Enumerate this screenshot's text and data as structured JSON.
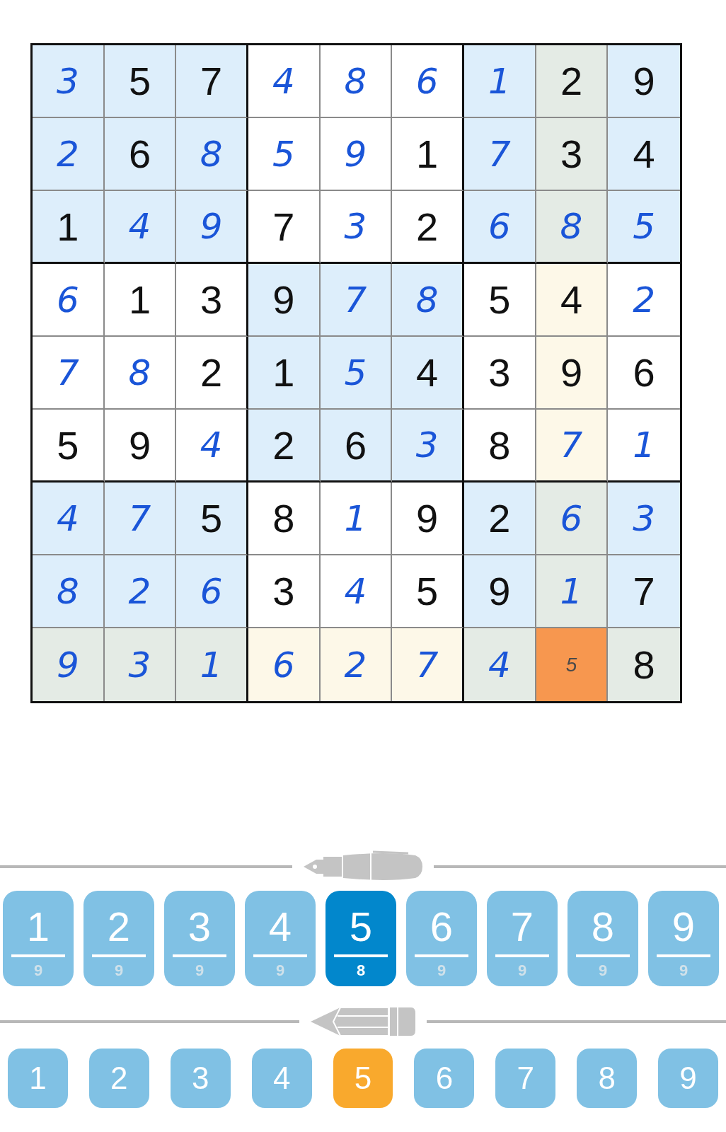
{
  "grid": {
    "rows": [
      [
        {
          "value": "3",
          "kind": "entered",
          "color": "#ddeefb"
        },
        {
          "value": "5",
          "kind": "given",
          "color": "#ddeefb"
        },
        {
          "value": "7",
          "kind": "given",
          "color": "#ddeefb"
        },
        {
          "value": "4",
          "kind": "entered",
          "color": "#ffffff"
        },
        {
          "value": "8",
          "kind": "entered",
          "color": "#ffffff"
        },
        {
          "value": "6",
          "kind": "entered",
          "color": "#ffffff"
        },
        {
          "value": "1",
          "kind": "entered",
          "color": "#ddeefb"
        },
        {
          "value": "2",
          "kind": "given",
          "color": "#e4ebe5"
        },
        {
          "value": "9",
          "kind": "given",
          "color": "#ddeefb"
        }
      ],
      [
        {
          "value": "2",
          "kind": "entered",
          "color": "#ddeefb"
        },
        {
          "value": "6",
          "kind": "given",
          "color": "#ddeefb"
        },
        {
          "value": "8",
          "kind": "entered",
          "color": "#ddeefb"
        },
        {
          "value": "5",
          "kind": "entered",
          "color": "#ffffff"
        },
        {
          "value": "9",
          "kind": "entered",
          "color": "#ffffff"
        },
        {
          "value": "1",
          "kind": "given",
          "color": "#ffffff"
        },
        {
          "value": "7",
          "kind": "entered",
          "color": "#ddeefb"
        },
        {
          "value": "3",
          "kind": "given",
          "color": "#e4ebe5"
        },
        {
          "value": "4",
          "kind": "given",
          "color": "#ddeefb"
        }
      ],
      [
        {
          "value": "1",
          "kind": "given",
          "color": "#ddeefb"
        },
        {
          "value": "4",
          "kind": "entered",
          "color": "#ddeefb"
        },
        {
          "value": "9",
          "kind": "entered",
          "color": "#ddeefb"
        },
        {
          "value": "7",
          "kind": "given",
          "color": "#ffffff"
        },
        {
          "value": "3",
          "kind": "entered",
          "color": "#ffffff"
        },
        {
          "value": "2",
          "kind": "given",
          "color": "#ffffff"
        },
        {
          "value": "6",
          "kind": "entered",
          "color": "#ddeefb"
        },
        {
          "value": "8",
          "kind": "entered",
          "color": "#e4ebe5"
        },
        {
          "value": "5",
          "kind": "entered",
          "color": "#ddeefb"
        }
      ],
      [
        {
          "value": "6",
          "kind": "entered",
          "color": "#ffffff"
        },
        {
          "value": "1",
          "kind": "given",
          "color": "#ffffff"
        },
        {
          "value": "3",
          "kind": "given",
          "color": "#ffffff"
        },
        {
          "value": "9",
          "kind": "given",
          "color": "#ddeefb"
        },
        {
          "value": "7",
          "kind": "entered",
          "color": "#ddeefb"
        },
        {
          "value": "8",
          "kind": "entered",
          "color": "#ddeefb"
        },
        {
          "value": "5",
          "kind": "given",
          "color": "#ffffff"
        },
        {
          "value": "4",
          "kind": "given",
          "color": "#fdf8e8"
        },
        {
          "value": "2",
          "kind": "entered",
          "color": "#ffffff"
        }
      ],
      [
        {
          "value": "7",
          "kind": "entered",
          "color": "#ffffff"
        },
        {
          "value": "8",
          "kind": "entered",
          "color": "#ffffff"
        },
        {
          "value": "2",
          "kind": "given",
          "color": "#ffffff"
        },
        {
          "value": "1",
          "kind": "given",
          "color": "#ddeefb"
        },
        {
          "value": "5",
          "kind": "entered",
          "color": "#ddeefb"
        },
        {
          "value": "4",
          "kind": "given",
          "color": "#ddeefb"
        },
        {
          "value": "3",
          "kind": "given",
          "color": "#ffffff"
        },
        {
          "value": "9",
          "kind": "given",
          "color": "#fdf8e8"
        },
        {
          "value": "6",
          "kind": "given",
          "color": "#ffffff"
        }
      ],
      [
        {
          "value": "5",
          "kind": "given",
          "color": "#ffffff"
        },
        {
          "value": "9",
          "kind": "given",
          "color": "#ffffff"
        },
        {
          "value": "4",
          "kind": "entered",
          "color": "#ffffff"
        },
        {
          "value": "2",
          "kind": "given",
          "color": "#ddeefb"
        },
        {
          "value": "6",
          "kind": "given",
          "color": "#ddeefb"
        },
        {
          "value": "3",
          "kind": "entered",
          "color": "#ddeefb"
        },
        {
          "value": "8",
          "kind": "given",
          "color": "#ffffff"
        },
        {
          "value": "7",
          "kind": "entered",
          "color": "#fdf8e8"
        },
        {
          "value": "1",
          "kind": "entered",
          "color": "#ffffff"
        }
      ],
      [
        {
          "value": "4",
          "kind": "entered",
          "color": "#ddeefb"
        },
        {
          "value": "7",
          "kind": "entered",
          "color": "#ddeefb"
        },
        {
          "value": "5",
          "kind": "given",
          "color": "#ddeefb"
        },
        {
          "value": "8",
          "kind": "given",
          "color": "#ffffff"
        },
        {
          "value": "1",
          "kind": "entered",
          "color": "#ffffff"
        },
        {
          "value": "9",
          "kind": "given",
          "color": "#ffffff"
        },
        {
          "value": "2",
          "kind": "given",
          "color": "#ddeefb"
        },
        {
          "value": "6",
          "kind": "entered",
          "color": "#e4ebe5"
        },
        {
          "value": "3",
          "kind": "entered",
          "color": "#ddeefb"
        }
      ],
      [
        {
          "value": "8",
          "kind": "entered",
          "color": "#ddeefb"
        },
        {
          "value": "2",
          "kind": "entered",
          "color": "#ddeefb"
        },
        {
          "value": "6",
          "kind": "entered",
          "color": "#ddeefb"
        },
        {
          "value": "3",
          "kind": "given",
          "color": "#ffffff"
        },
        {
          "value": "4",
          "kind": "entered",
          "color": "#ffffff"
        },
        {
          "value": "5",
          "kind": "given",
          "color": "#ffffff"
        },
        {
          "value": "9",
          "kind": "given",
          "color": "#ddeefb"
        },
        {
          "value": "1",
          "kind": "entered",
          "color": "#e4ebe5"
        },
        {
          "value": "7",
          "kind": "given",
          "color": "#ddeefb"
        }
      ],
      [
        {
          "value": "9",
          "kind": "entered",
          "color": "#e4ebe5"
        },
        {
          "value": "3",
          "kind": "entered",
          "color": "#e4ebe5"
        },
        {
          "value": "1",
          "kind": "entered",
          "color": "#e4ebe5"
        },
        {
          "value": "6",
          "kind": "entered",
          "color": "#fdf8e8"
        },
        {
          "value": "2",
          "kind": "entered",
          "color": "#fdf8e8"
        },
        {
          "value": "7",
          "kind": "entered",
          "color": "#fdf8e8"
        },
        {
          "value": "4",
          "kind": "entered",
          "color": "#e4ebe5"
        },
        {
          "value": "5",
          "kind": "note",
          "color": "#f7974f"
        },
        {
          "value": "8",
          "kind": "given",
          "color": "#e4ebe5"
        }
      ]
    ]
  },
  "pen_buttons": [
    {
      "digit": "1",
      "count": "9",
      "selected": false
    },
    {
      "digit": "2",
      "count": "9",
      "selected": false
    },
    {
      "digit": "3",
      "count": "9",
      "selected": false
    },
    {
      "digit": "4",
      "count": "9",
      "selected": false
    },
    {
      "digit": "5",
      "count": "8",
      "selected": true
    },
    {
      "digit": "6",
      "count": "9",
      "selected": false
    },
    {
      "digit": "7",
      "count": "9",
      "selected": false
    },
    {
      "digit": "8",
      "count": "9",
      "selected": false
    },
    {
      "digit": "9",
      "count": "9",
      "selected": false
    }
  ],
  "pencil_buttons": [
    {
      "digit": "1",
      "selected": false
    },
    {
      "digit": "2",
      "selected": false
    },
    {
      "digit": "3",
      "selected": false
    },
    {
      "digit": "4",
      "selected": false
    },
    {
      "digit": "5",
      "selected": true
    },
    {
      "digit": "6",
      "selected": false
    },
    {
      "digit": "7",
      "selected": false
    },
    {
      "digit": "8",
      "selected": false
    },
    {
      "digit": "9",
      "selected": false
    }
  ]
}
